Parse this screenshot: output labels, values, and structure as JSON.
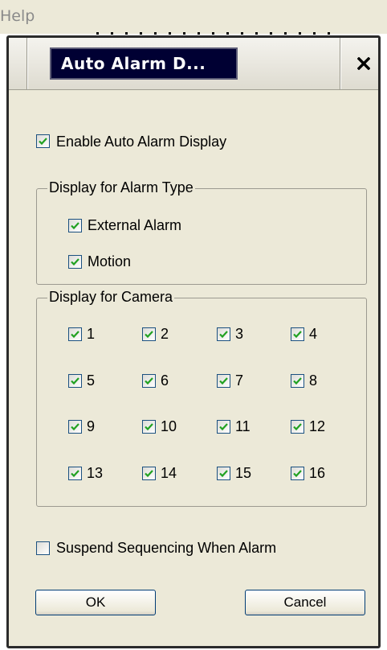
{
  "menubar": {
    "help_label": "Help"
  },
  "dialog": {
    "title": "Auto Alarm D...",
    "close_glyph": "✕",
    "enable_auto_alarm": {
      "label": "Enable Auto Alarm Display",
      "checked": true
    },
    "alarm_type_group": {
      "legend": "Display for Alarm Type",
      "items": [
        {
          "label": "External Alarm",
          "checked": true
        },
        {
          "label": "Motion",
          "checked": true
        }
      ]
    },
    "camera_group": {
      "legend": "Display for Camera",
      "cameras": [
        {
          "label": "1",
          "checked": true
        },
        {
          "label": "2",
          "checked": true
        },
        {
          "label": "3",
          "checked": true
        },
        {
          "label": "4",
          "checked": true
        },
        {
          "label": "5",
          "checked": true
        },
        {
          "label": "6",
          "checked": true
        },
        {
          "label": "7",
          "checked": true
        },
        {
          "label": "8",
          "checked": true
        },
        {
          "label": "9",
          "checked": true
        },
        {
          "label": "10",
          "checked": true
        },
        {
          "label": "11",
          "checked": true
        },
        {
          "label": "12",
          "checked": true
        },
        {
          "label": "13",
          "checked": true
        },
        {
          "label": "14",
          "checked": true
        },
        {
          "label": "15",
          "checked": true
        },
        {
          "label": "16",
          "checked": true
        }
      ]
    },
    "suspend_sequencing": {
      "label": "Suspend Sequencing When Alarm",
      "checked": false
    },
    "ok_label": "OK",
    "cancel_label": "Cancel"
  }
}
